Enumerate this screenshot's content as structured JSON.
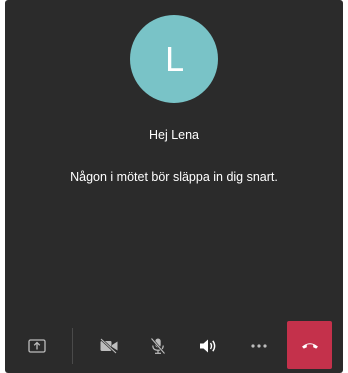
{
  "participant": {
    "initial": "L",
    "avatar_color": "#79c3c7"
  },
  "lobby": {
    "greeting": "Hej Lena",
    "message": "Någon i mötet bör släppa in dig snart."
  },
  "toolbar": {
    "buttons": [
      {
        "name": "share-tray",
        "icon": "share-icon"
      },
      {
        "name": "camera-toggle",
        "icon": "camera-off-icon"
      },
      {
        "name": "mic-toggle",
        "icon": "mic-off-icon"
      },
      {
        "name": "speaker",
        "icon": "speaker-icon"
      },
      {
        "name": "more-actions",
        "icon": "more-icon"
      },
      {
        "name": "hang-up",
        "icon": "hang-up-icon"
      }
    ]
  },
  "colors": {
    "background": "#2b2b2b",
    "hangup": "#c4314b",
    "icon_bright": "#ffffff",
    "icon_dim": "#bdbdbd"
  }
}
